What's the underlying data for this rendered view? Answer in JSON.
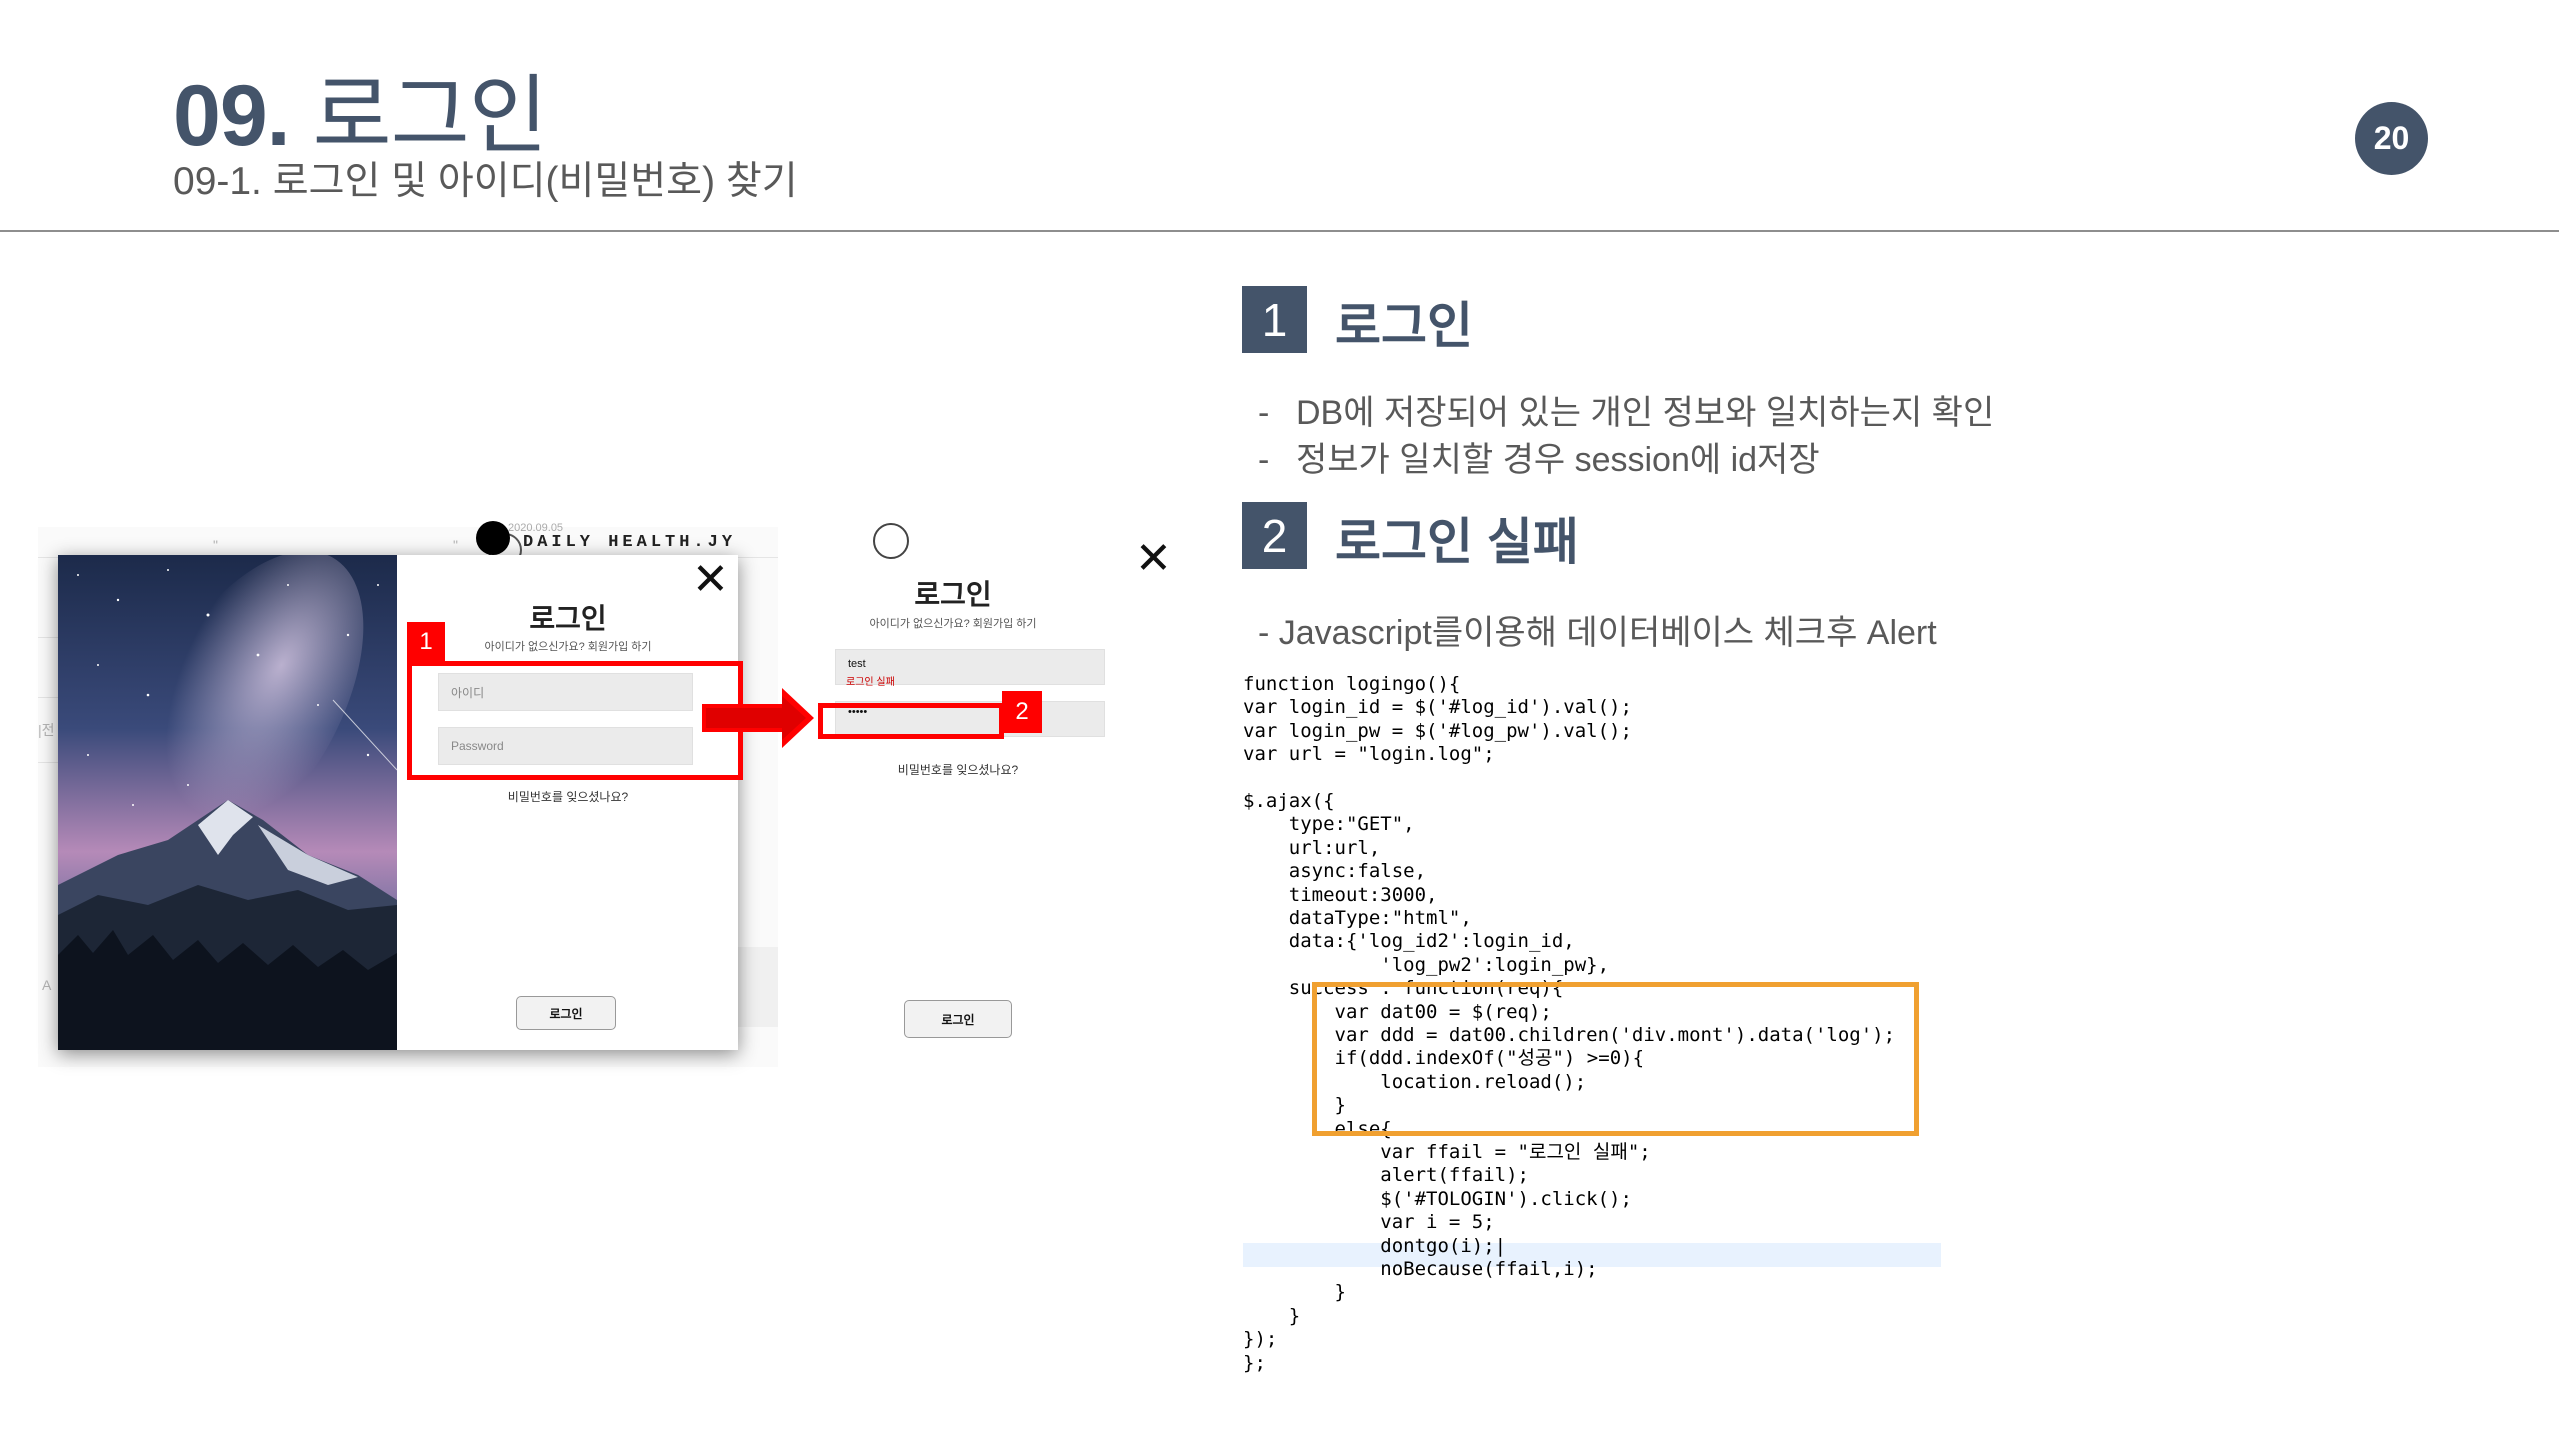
{
  "header": {
    "title_num": "09.",
    "title_text": "로그인",
    "subtitle": "09-1. 로그인 및 아이디(비밀번호) 찾기",
    "page_number": "20"
  },
  "screenshot": {
    "brand": "DAILY HEALTH.JY",
    "brand_date": "2020.09.05",
    "faded_marks": [
      "\"",
      "\"",
      "|전",
      "A"
    ],
    "login_modal": {
      "close": "✕",
      "heading": "로그인",
      "hint": "아이디가 없으신가요? 회원가입 하기",
      "id_placeholder": "아이디",
      "pw_placeholder": "Password",
      "forgot": "비밀번호를 잊으셨나요?",
      "button": "로그인"
    },
    "failed_modal": {
      "close": "✕",
      "heading": "로그인",
      "hint": "아이디가 없으신가요? 회원가입 하기",
      "id_value": "test",
      "fail_message": "로그인 실패",
      "pw_value": "•••••",
      "forgot": "비밀번호를 잊으셨나요?",
      "button": "로그인"
    },
    "badge_1": "1",
    "badge_2": "2",
    "arrow_color": "#ff0000"
  },
  "section1": {
    "number": "1",
    "title": "로그인",
    "bullets": [
      "DB에 저장되어 있는 개인 정보와 일치하는지 확인",
      "정보가 일치할 경우 session에 id저장"
    ]
  },
  "section2": {
    "number": "2",
    "title": "로그인 실패",
    "description": "- Javascript를이용해 데이터베이스 체크후 Alert"
  },
  "code": {
    "lines": [
      "function logingo(){",
      "var login_id = $('#log_id').val();",
      "var login_pw = $('#log_pw').val();",
      "var url = \"login.log\";",
      "",
      "$.ajax({",
      "    type:\"GET\",",
      "    url:url,",
      "    async:false,",
      "    timeout:3000,",
      "    dataType:\"html\",",
      "    data:{'log_id2':login_id,",
      "            'log_pw2':login_pw},",
      "    success : function(req){",
      "        var dat00 = $(req);",
      "        var ddd = dat00.children('div.mont').data('log');",
      "        if(ddd.indexOf(\"성공\") >=0){",
      "            location.reload();",
      "        }",
      "        else{",
      "            var ffail = \"로그인 실패\";",
      "            alert(ffail);",
      "            $('#TOLOGIN').click();",
      "            var i = 5;",
      "            dontgo(i);|",
      "            noBecause(ffail,i);",
      "        }",
      "    }",
      "});",
      "};"
    ],
    "highlight_color": "#f0a030",
    "keyword_color": "#7f0055"
  }
}
